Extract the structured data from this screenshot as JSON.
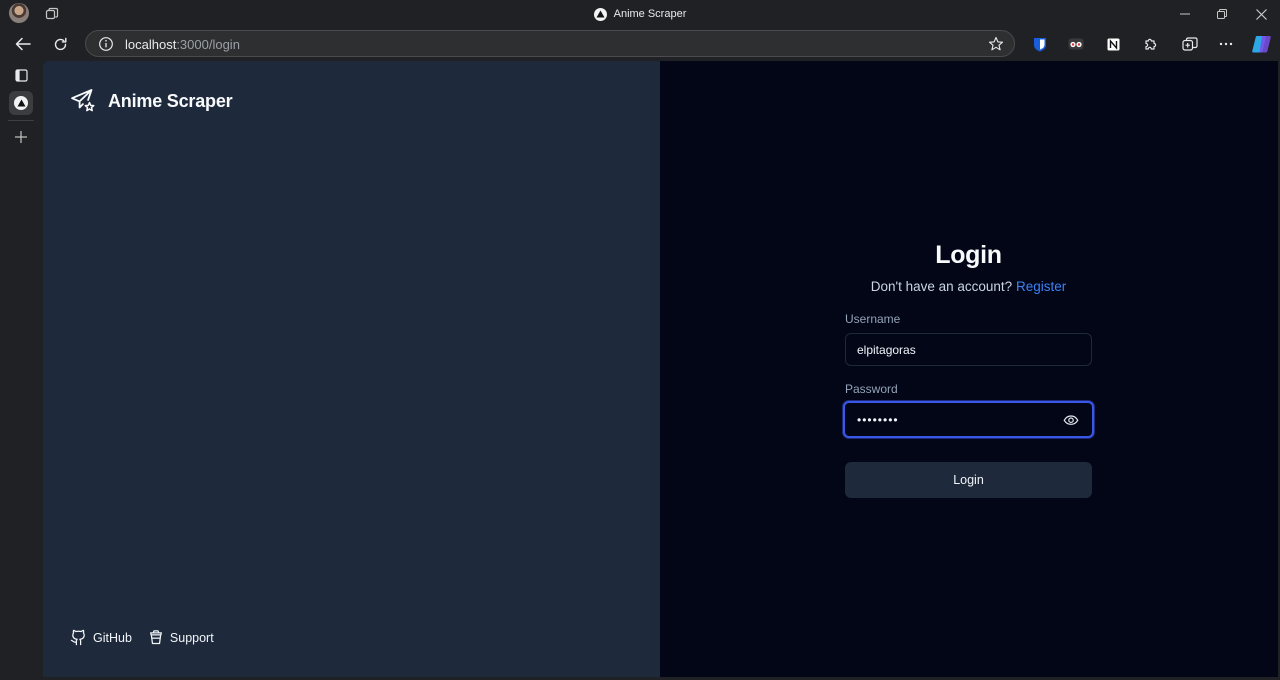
{
  "window": {
    "title": "Anime Scraper"
  },
  "address_bar": {
    "host": "localhost",
    "path": ":3000/login"
  },
  "page": {
    "brand": "Anime Scraper",
    "footer_links": [
      {
        "label": "GitHub",
        "icon": "github-icon"
      },
      {
        "label": "Support",
        "icon": "cup-icon"
      }
    ],
    "login": {
      "title": "Login",
      "subtitle": "Don't have an account?",
      "register_link": "Register",
      "username_label": "Username",
      "username_value": "elpitagoras",
      "password_label": "Password",
      "password_value": "••••••••",
      "submit_label": "Login"
    }
  },
  "colors": {
    "left_pane": "#1e293b",
    "right_pane": "#020617",
    "accent_link": "#3b82f6",
    "focus_ring": "#3b57e8"
  }
}
